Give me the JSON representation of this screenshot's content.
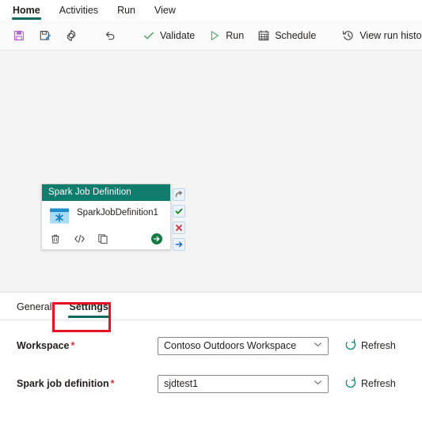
{
  "menubar": {
    "items": [
      {
        "label": "Home",
        "active": true
      },
      {
        "label": "Activities",
        "active": false
      },
      {
        "label": "Run",
        "active": false
      },
      {
        "label": "View",
        "active": false
      }
    ]
  },
  "toolbar": {
    "save_label": "",
    "save_icon": "save-icon",
    "save_as_icon": "save-as-icon",
    "settings_icon": "gear-icon",
    "undo_icon": "undo-icon",
    "validate_label": "Validate",
    "validate_icon": "checkmark-icon",
    "run_label": "Run",
    "run_icon": "play-icon",
    "schedule_label": "Schedule",
    "schedule_icon": "calendar-icon",
    "view_run_history_label": "View run history",
    "view_run_history_icon": "history-icon"
  },
  "canvas": {
    "node": {
      "header": "Spark Job Definition",
      "label": "SparkJobDefinition1",
      "type_icon": "spark-job-definition-icon",
      "actions": [
        {
          "name": "delete-icon"
        },
        {
          "name": "code-icon"
        },
        {
          "name": "duplicate-icon"
        }
      ],
      "run_icon": "run-arrow-icon",
      "connectors": [
        {
          "name": "skip-connector-icon"
        },
        {
          "name": "success-connector-icon"
        },
        {
          "name": "failure-connector-icon"
        },
        {
          "name": "completion-connector-icon"
        }
      ]
    }
  },
  "properties": {
    "tabs": [
      {
        "label": "General",
        "active": false
      },
      {
        "label": "Settings",
        "active": true
      }
    ],
    "fields": [
      {
        "label": "Workspace",
        "required": "*",
        "value": "Contoso Outdoors Workspace",
        "refresh_label": "Refresh"
      },
      {
        "label": "Spark job definition",
        "required": "*",
        "value": "sjdtest1",
        "refresh_label": "Refresh"
      }
    ]
  },
  "colors": {
    "accent_green": "#0f6a5b",
    "node_header": "#107c6e",
    "annotation_red": "#e81123",
    "required_red": "#d13438",
    "canvas_bg": "#f4f4f4"
  }
}
